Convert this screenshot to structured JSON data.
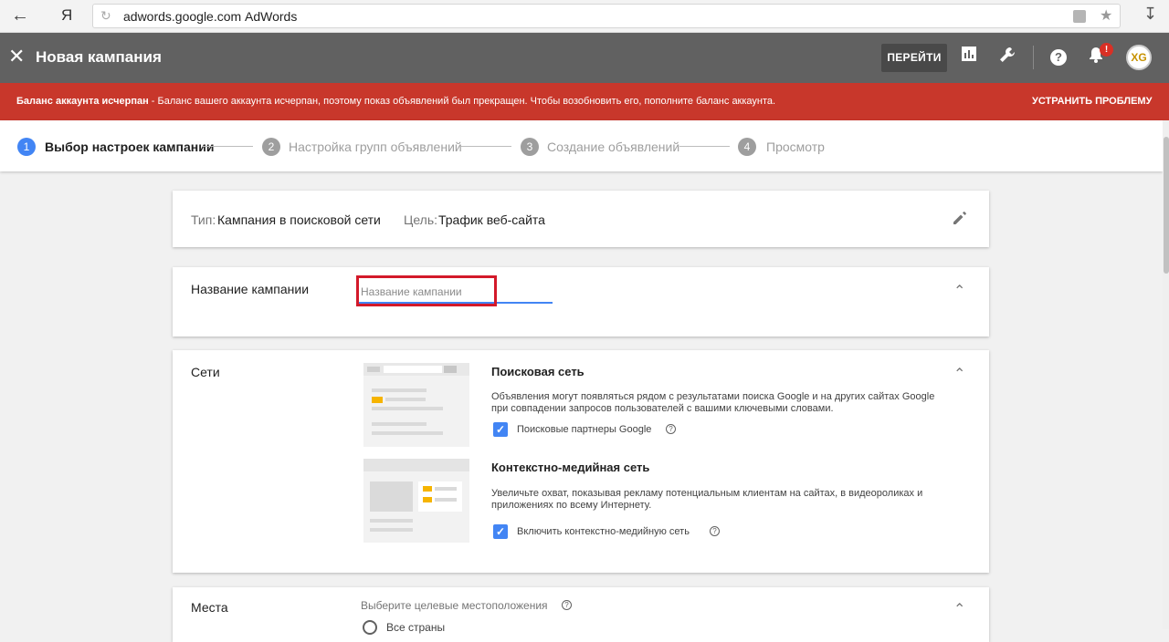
{
  "browser": {
    "url": "adwords.google.com",
    "page_title": "AdWords",
    "yandex_label": "Я"
  },
  "appbar": {
    "title": "Новая кампания",
    "go_button": "ПЕРЕЙТИ",
    "notification_badge": "!",
    "avatar_text": "XG"
  },
  "alert": {
    "bold_text": "Баланс аккаунта исчерпан",
    "text": " - Баланс вашего аккаунта исчерпан, поэтому показ объявлений был прекращен. Чтобы возобновить его, пополните баланс аккаунта.",
    "action": "УСТРАНИТЬ ПРОБЛЕМУ",
    "color": "#c8372b"
  },
  "steps": [
    {
      "num": "1",
      "label": "Выбор настроек кампании"
    },
    {
      "num": "2",
      "label": "Настройка групп объявлений"
    },
    {
      "num": "3",
      "label": "Создание объявлений"
    },
    {
      "num": "4",
      "label": "Просмотр"
    }
  ],
  "summary": {
    "type_label": "Тип:",
    "type_value": "Кампания в поисковой сети",
    "goal_label": "Цель:",
    "goal_value": "Трафик веб-сайта"
  },
  "campaign_name": {
    "label": "Название кампании",
    "placeholder": "Название кампании",
    "value": ""
  },
  "networks": {
    "label": "Сети",
    "search": {
      "title": "Поисковая сеть",
      "desc": "Объявления могут появляться рядом с результатами поиска Google и на других сайтах Google при совпадении запросов пользователей с вашими ключевыми словами.",
      "checkbox_label": "Поисковые партнеры Google",
      "checked": true
    },
    "display": {
      "title": "Контекстно-медийная сеть",
      "desc": "Увеличьте охват, показывая рекламу потенциальным клиентам на сайтах, в видеороликах и приложениях по всему Интернету.",
      "checkbox_label": "Включить контекстно-медийную сеть",
      "checked": true
    }
  },
  "places": {
    "label": "Места",
    "hint": "Выберите целевые местоположения",
    "option_all": "Все страны"
  },
  "icons": {
    "back": "arrow-left-icon",
    "reload": "reload-icon",
    "lock": "lock-icon",
    "star": "star-icon",
    "download": "download-icon",
    "close": "close-icon",
    "reports": "bar-chart-icon",
    "tools": "wrench-icon",
    "help": "help-icon",
    "notifications": "bell-icon",
    "edit": "pencil-icon",
    "collapse": "chevron-up-icon",
    "check": "check-icon"
  },
  "colors": {
    "accent": "#4285f4",
    "appbar": "#616161",
    "highlight_box": "#d3192a"
  }
}
